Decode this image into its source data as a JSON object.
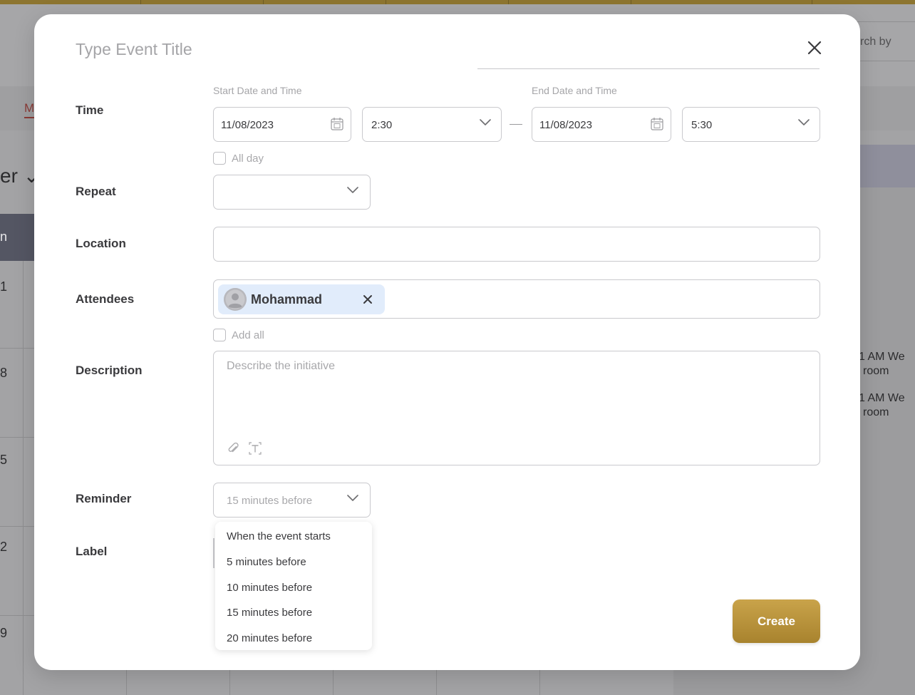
{
  "background": {
    "tab_initial": "M",
    "search_fragment": "rch by",
    "month_fragment": "er ⌄",
    "dayhead_fragment": "n",
    "row_numbers": [
      "1",
      "8",
      "5",
      "2",
      "9"
    ],
    "events": [
      {
        "time": "1 AM We",
        "room": "room"
      },
      {
        "time": "1 AM We",
        "room": "room"
      }
    ]
  },
  "modal": {
    "title_placeholder": "Type Event Title",
    "labels": {
      "time": "Time",
      "repeat": "Repeat",
      "location": "Location",
      "attendees": "Attendees",
      "description": "Description",
      "reminder": "Reminder",
      "label": "Label"
    },
    "time": {
      "start_label": "Start Date and Time",
      "end_label": "End Date and Time",
      "start_date": "11/08/2023",
      "start_time": "2:30",
      "end_date": "11/08/2023",
      "end_time": "5:30",
      "all_day_label": "All day",
      "all_day_checked": false
    },
    "repeat": {
      "value": ""
    },
    "location": {
      "value": ""
    },
    "attendees": {
      "chips": [
        {
          "name": "Mohammad"
        }
      ],
      "add_all_label": "Add all",
      "add_all_checked": false
    },
    "description": {
      "placeholder": "Describe the initiative"
    },
    "reminder": {
      "selected": "15 minutes before",
      "options": [
        "When the event starts",
        "5 minutes before",
        "10 minutes before",
        "15 minutes before",
        "20 minutes before"
      ]
    },
    "create_label": "Create",
    "accent_color": "#b8923c"
  }
}
